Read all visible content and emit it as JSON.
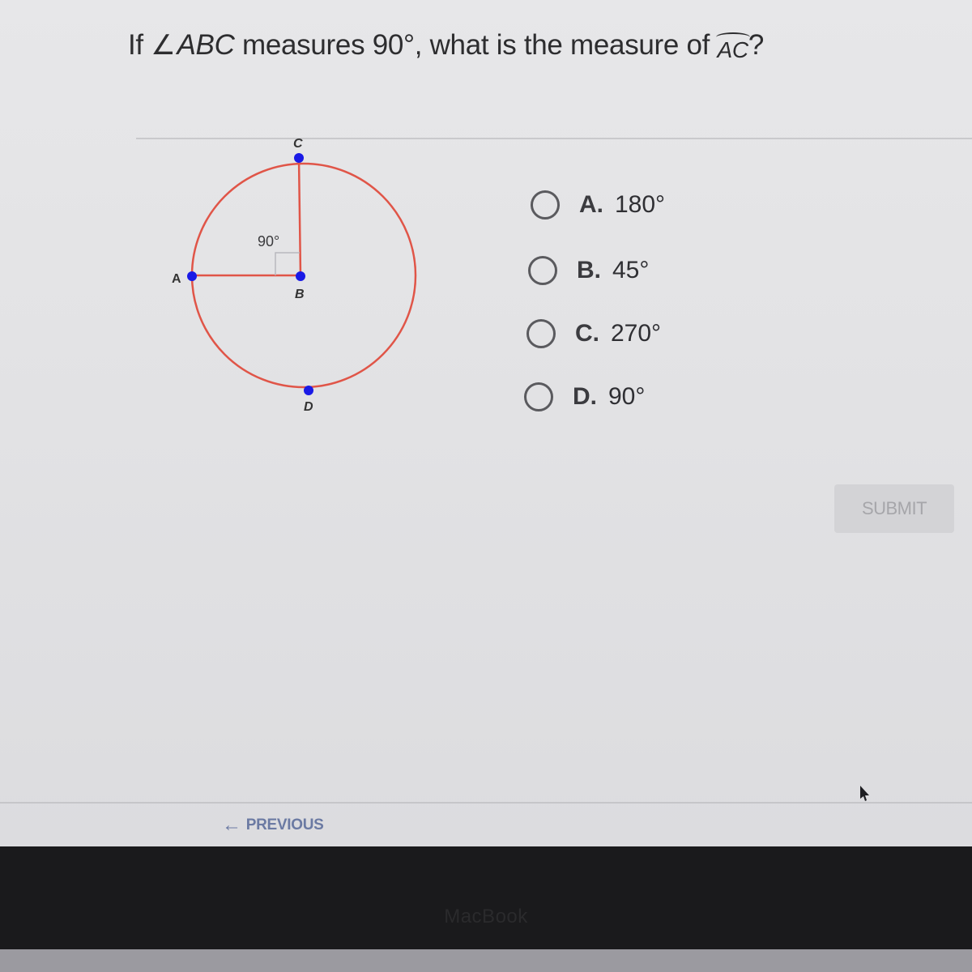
{
  "question": {
    "prefix": "If",
    "angle_symbol": "∠",
    "angle_name": "ABC",
    "middle": "measures 90°, what is the measure of",
    "arc_name": "AC",
    "suffix": "?"
  },
  "diagram": {
    "points": {
      "A": "A",
      "B": "B",
      "C": "C",
      "D": "D"
    },
    "angle_label": "90°",
    "colors": {
      "circle": "#e05548",
      "point": "#1a1ae6",
      "right_angle_box": "#b8b8bd"
    }
  },
  "options": [
    {
      "letter": "A.",
      "value": "180°"
    },
    {
      "letter": "B.",
      "value": "45°"
    },
    {
      "letter": "C.",
      "value": "270°"
    },
    {
      "letter": "D.",
      "value": "90°"
    }
  ],
  "submit": {
    "label": "SUBMIT"
  },
  "nav": {
    "previous_label": "PREVIOUS",
    "previous_icon": "arrow-left-icon"
  },
  "bezel": {
    "brand": "MacBook"
  }
}
